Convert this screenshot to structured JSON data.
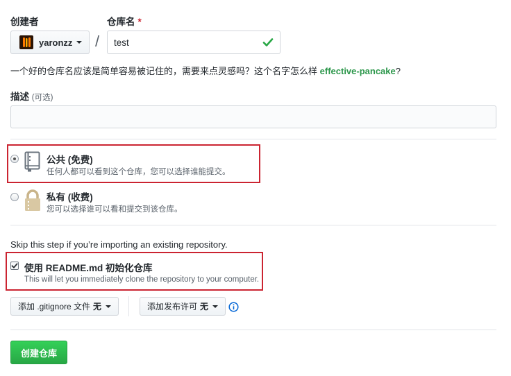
{
  "owner": {
    "label": "创建者",
    "name": "yaronzz"
  },
  "repository": {
    "label": "仓库名",
    "required_mark": "*",
    "separator": "/",
    "value": "test",
    "valid_icon": "check-icon",
    "suggestion_prefix": "一个好的仓库名应该是简单容易被记住的，需要来点灵感吗？这个名字怎么样",
    "suggestion_name": "effective-pancake",
    "suggestion_suffix": "?"
  },
  "description": {
    "label": "描述",
    "optional": "(可选)",
    "value": ""
  },
  "visibility": {
    "selected": "public",
    "public": {
      "title": "公共 (免费)",
      "note": "任何人都可以看到这个仓库，您可以选择谁能提交。",
      "icon": "repo-book-icon"
    },
    "private": {
      "title": "私有 (收费)",
      "note": "您可以选择谁可以看和提交到该仓库。",
      "icon": "lock-icon"
    }
  },
  "init": {
    "skip_note": "Skip this step if you’re importing an existing repository.",
    "readme_label": "使用 README.md 初始化仓库",
    "readme_checked": true,
    "readme_note": "This will let you immediately clone the repository to your computer."
  },
  "gitignore": {
    "label": "添加 .gitignore 文件",
    "value": "无"
  },
  "license": {
    "label": "添加发布许可",
    "value": "无",
    "info_icon": "info-icon"
  },
  "submit": {
    "label": "创建仓库"
  },
  "colors": {
    "accent_green": "#2c974b",
    "button_green": "#28a745",
    "highlight_red": "#cb2431",
    "info_blue": "#0366d6"
  }
}
